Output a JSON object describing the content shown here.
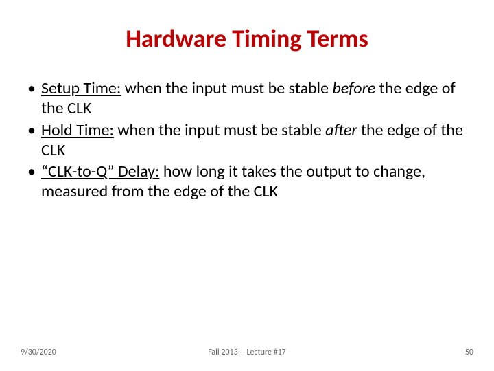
{
  "title": "Hardware Timing Terms",
  "bullets": [
    {
      "term": "Setup Time:",
      "rest1": " when the input must be stable ",
      "emph": "before",
      "rest2": " the edge of the CLK"
    },
    {
      "term": "Hold Time:",
      "rest1": " when the input must be stable ",
      "emph": "after",
      "rest2": " the edge of the CLK"
    },
    {
      "term": "“CLK-to-Q” Delay:",
      "rest1": " how long it takes the output to change, measured from the edge of the CLK",
      "emph": "",
      "rest2": ""
    }
  ],
  "footer": {
    "left": "9/30/2020",
    "center": "Fall 2013 -- Lecture #17",
    "right": "50"
  }
}
